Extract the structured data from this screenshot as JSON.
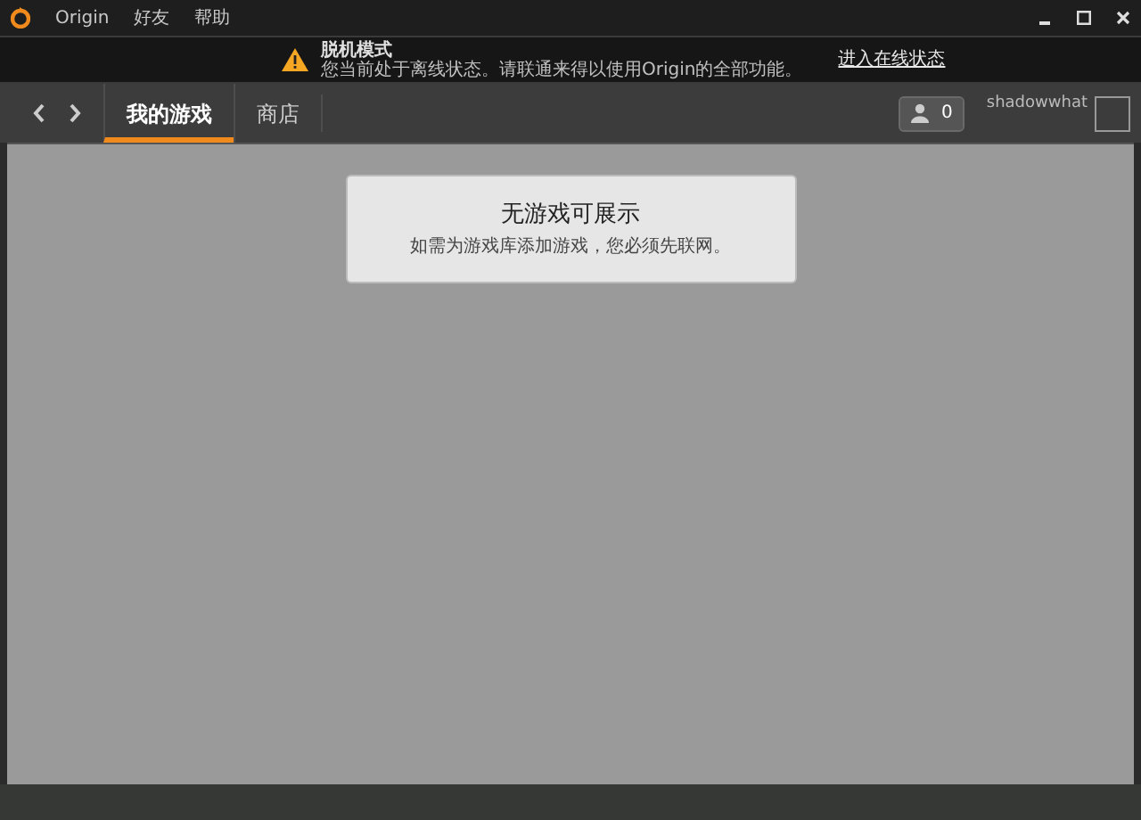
{
  "menu": [
    "Origin",
    "好友",
    "帮助"
  ],
  "banner": {
    "title": "脱机模式",
    "message": "您当前处于离线状态。请联通来得以使用Origin的全部功能。",
    "link": "进入在线状态"
  },
  "tabs": [
    {
      "label": "我的游戏",
      "selected": true
    },
    {
      "label": "商店",
      "selected": false
    }
  ],
  "friends_count": "0",
  "username": "shadowwhat",
  "notice": {
    "title": "无游戏可展示",
    "message": "如需为游戏库添加游戏，您必须先联网。"
  }
}
